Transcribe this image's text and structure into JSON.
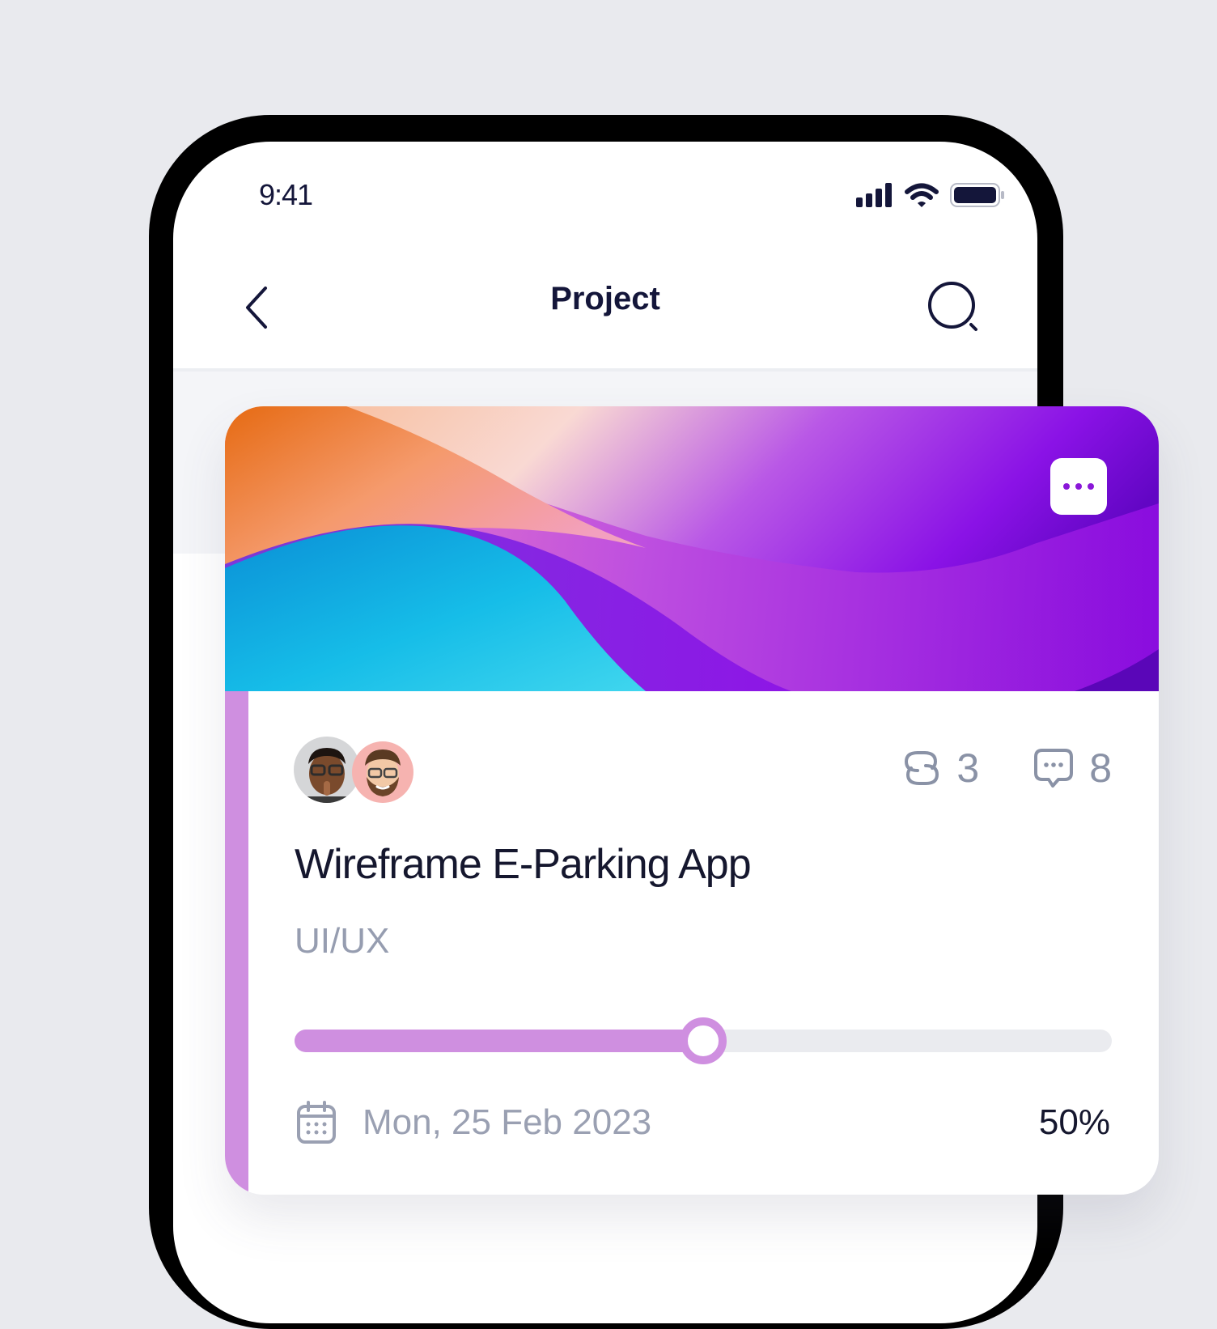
{
  "status_bar": {
    "time": "9:41"
  },
  "nav": {
    "title": "Project",
    "back_icon": "chevron-left-icon",
    "search_icon": "search-icon"
  },
  "card": {
    "title": "Wireframe E-Parking App",
    "category": "UI/UX",
    "attachments_count": "3",
    "comments_count": "8",
    "due_date": "Mon, 25 Feb 2023",
    "progress_label": "50%",
    "progress_value": 0.5,
    "more_icon": "more-horizontal-icon"
  },
  "colors": {
    "accent": "#cf8fe0",
    "text_dark": "#15172e",
    "text_muted": "#969db0",
    "background": "#e9eaee"
  }
}
